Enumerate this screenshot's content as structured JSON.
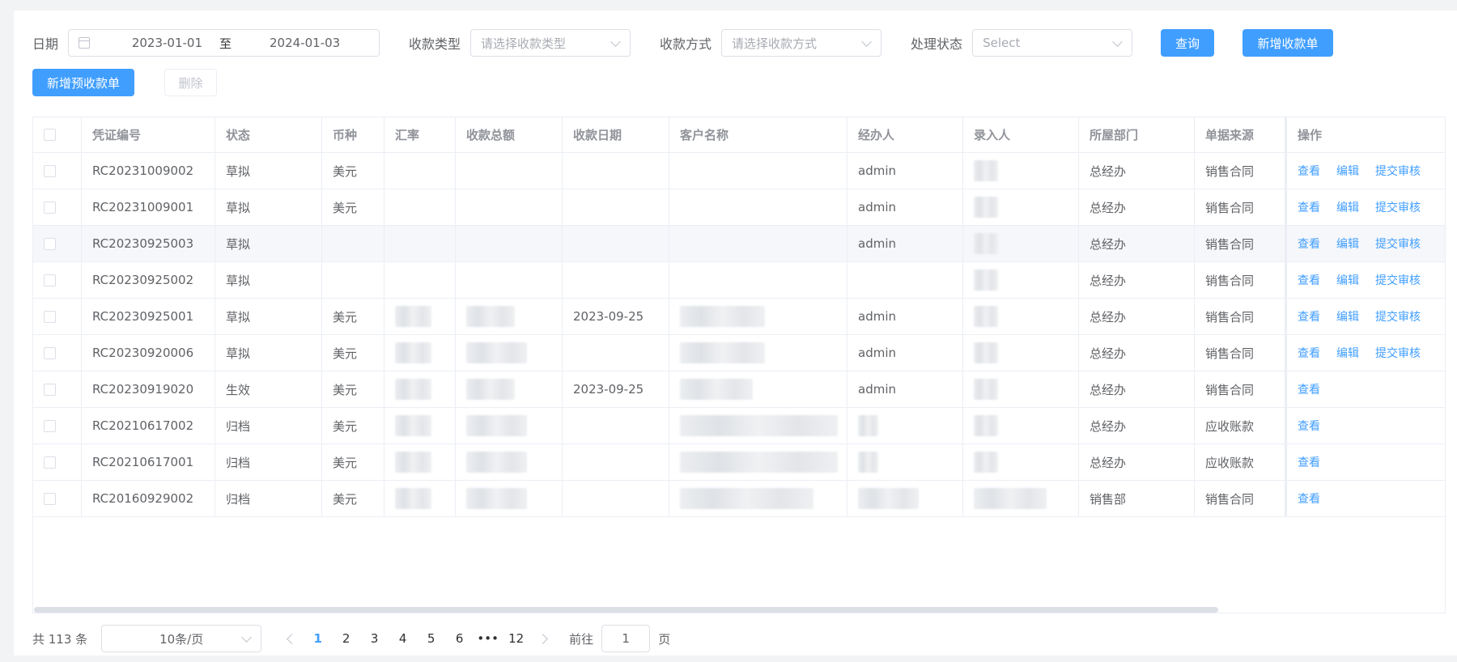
{
  "filters": {
    "date_label": "日期",
    "date_start": "2023-01-01",
    "date_sep": "至",
    "date_end": "2024-01-03",
    "type_label": "收款类型",
    "type_placeholder": "请选择收款类型",
    "method_label": "收款方式",
    "method_placeholder": "请选择收款方式",
    "status_label": "处理状态",
    "status_placeholder": "Select"
  },
  "buttons": {
    "query": "查询",
    "add_receipt": "新增收款单",
    "add_prereceipt": "新增预收款单",
    "delete": "删除"
  },
  "table": {
    "columns": [
      "凭证编号",
      "状态",
      "币种",
      "汇率",
      "收款总额",
      "收款日期",
      "客户名称",
      "经办人",
      "录入人",
      "所屋部门",
      "单据来源",
      "操作"
    ],
    "actions": {
      "view": "查看",
      "edit": "编辑",
      "submit": "提交审核"
    },
    "rows": [
      {
        "code": "RC20231009002",
        "status": "草拟",
        "currency": "美元",
        "date": "",
        "handler": "admin",
        "dept": "总经办",
        "source": "销售合同",
        "editable": true
      },
      {
        "code": "RC20231009001",
        "status": "草拟",
        "currency": "美元",
        "date": "",
        "handler": "admin",
        "dept": "总经办",
        "source": "销售合同",
        "editable": true
      },
      {
        "code": "RC20230925003",
        "status": "草拟",
        "currency": "",
        "date": "",
        "handler": "admin",
        "dept": "总经办",
        "source": "销售合同",
        "editable": true
      },
      {
        "code": "RC20230925002",
        "status": "草拟",
        "currency": "",
        "date": "",
        "handler": "",
        "dept": "总经办",
        "source": "销售合同",
        "editable": true
      },
      {
        "code": "RC20230925001",
        "status": "草拟",
        "currency": "美元",
        "date": "2023-09-25",
        "handler": "admin",
        "dept": "总经办",
        "source": "销售合同",
        "editable": true
      },
      {
        "code": "RC20230920006",
        "status": "草拟",
        "currency": "美元",
        "date": "",
        "handler": "admin",
        "dept": "总经办",
        "source": "销售合同",
        "editable": true
      },
      {
        "code": "RC20230919020",
        "status": "生效",
        "currency": "美元",
        "date": "2023-09-25",
        "handler": "admin",
        "dept": "总经办",
        "source": "销售合同",
        "editable": false
      },
      {
        "code": "RC20210617002",
        "status": "归档",
        "currency": "美元",
        "date": "",
        "handler": "",
        "dept": "总经办",
        "source": "应收账款",
        "editable": false
      },
      {
        "code": "RC20210617001",
        "status": "归档",
        "currency": "美元",
        "date": "",
        "handler": "",
        "dept": "总经办",
        "source": "应收账款",
        "editable": false
      },
      {
        "code": "RC20160929002",
        "status": "归档",
        "currency": "美元",
        "date": "",
        "handler": "",
        "dept": "销售部",
        "source": "销售合同",
        "editable": false
      }
    ]
  },
  "pagination": {
    "total_text": "共 113 条",
    "page_size": "10条/页",
    "pages": [
      "1",
      "2",
      "3",
      "4",
      "5",
      "6",
      "•••",
      "12"
    ],
    "current_page": "1",
    "goto_label": "前往",
    "goto_value": "1",
    "goto_suffix": "页"
  }
}
